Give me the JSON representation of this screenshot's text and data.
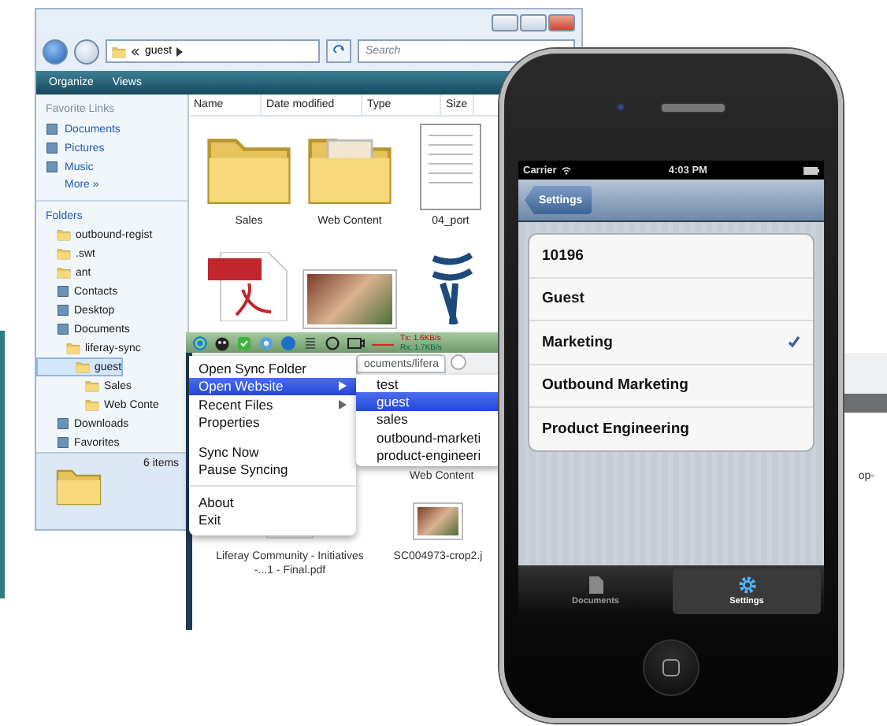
{
  "explorer": {
    "address": "guest",
    "search": {
      "placeholder": "Search"
    },
    "toolbar": [
      "Organize",
      "Views"
    ],
    "columns": [
      "Name",
      "Date modified",
      "Type",
      "Size"
    ],
    "favorites_heading": "Favorite Links",
    "favorites": [
      {
        "label": "Documents"
      },
      {
        "label": "Pictures"
      },
      {
        "label": "Music"
      }
    ],
    "more": "More »",
    "folders_heading": "Folders",
    "folders": [
      {
        "label": "outbound-regist",
        "kind": "folder",
        "selected": false
      },
      {
        "label": ".swt",
        "kind": "folder",
        "selected": false
      },
      {
        "label": "ant",
        "kind": "folder",
        "selected": false
      },
      {
        "label": "Contacts",
        "kind": "special",
        "selected": false
      },
      {
        "label": "Desktop",
        "kind": "special",
        "selected": false
      },
      {
        "label": "Documents",
        "kind": "special",
        "selected": false,
        "children": [
          {
            "label": "liferay-sync",
            "kind": "folder",
            "selected": false,
            "children": [
              {
                "label": "guest",
                "kind": "folder",
                "selected": true,
                "children": [
                  {
                    "label": "Sales",
                    "kind": "folder",
                    "selected": false
                  },
                  {
                    "label": "Web Conte",
                    "kind": "folder",
                    "selected": false
                  }
                ]
              }
            ]
          }
        ]
      },
      {
        "label": "Downloads",
        "kind": "special",
        "selected": false
      },
      {
        "label": "Favorites",
        "kind": "special",
        "selected": false
      }
    ],
    "files": [
      {
        "name": "Sales",
        "kind": "folder"
      },
      {
        "name": "Web Content",
        "kind": "photo-folder"
      },
      {
        "name": "04_port",
        "kind": "document"
      },
      {
        "kind": "pdf"
      },
      {
        "kind": "photo"
      },
      {
        "kind": "logo"
      }
    ],
    "status": "6 items"
  },
  "tray": {
    "path_tab": "ocuments/lifera",
    "tx_label": "Tx:",
    "tx": "1.6KB/s",
    "rx_label": "Rx:",
    "rx": "1.7KB/s"
  },
  "context_menu": {
    "items": [
      {
        "label": "Open Sync Folder",
        "kind": "item",
        "selected": false
      },
      {
        "label": "Open Website",
        "kind": "submenu",
        "selected": true
      },
      {
        "label": "Recent Files",
        "kind": "submenu",
        "selected": false
      },
      {
        "label": "Properties",
        "kind": "item",
        "selected": false
      },
      {
        "kind": "gap"
      },
      {
        "label": "Sync Now",
        "kind": "item",
        "selected": false
      },
      {
        "label": "Pause Syncing",
        "kind": "item",
        "selected": false
      },
      {
        "kind": "separator"
      },
      {
        "label": "About",
        "kind": "item",
        "selected": false
      },
      {
        "label": "Exit",
        "kind": "item",
        "selected": false
      }
    ],
    "submenu": [
      {
        "label": "test",
        "selected": false
      },
      {
        "label": "guest",
        "selected": true
      },
      {
        "label": "sales",
        "selected": false
      },
      {
        "label": "outbound-marketi",
        "selected": false
      },
      {
        "label": "product-engineeri",
        "selected": false
      }
    ]
  },
  "finder": {
    "top_labels": [
      "Web Content",
      "op-"
    ],
    "files": [
      {
        "name": "Liferay Community - Initiatives -...1 - Final.pdf",
        "kind": "document"
      },
      {
        "name": "SC004973-crop2.j",
        "kind": "photo"
      }
    ]
  },
  "phone": {
    "carrier": "Carrier",
    "time": "4:03 PM",
    "back": "Settings",
    "rows": [
      {
        "label": "10196",
        "checked": false
      },
      {
        "label": "Guest",
        "checked": false
      },
      {
        "label": "Marketing",
        "checked": true
      },
      {
        "label": "Outbound Marketing",
        "checked": false
      },
      {
        "label": "Product Engineering",
        "checked": false
      }
    ],
    "tabs": [
      {
        "label": "Documents",
        "kind": "documents",
        "selected": false
      },
      {
        "label": "Settings",
        "kind": "settings",
        "selected": true
      }
    ]
  }
}
